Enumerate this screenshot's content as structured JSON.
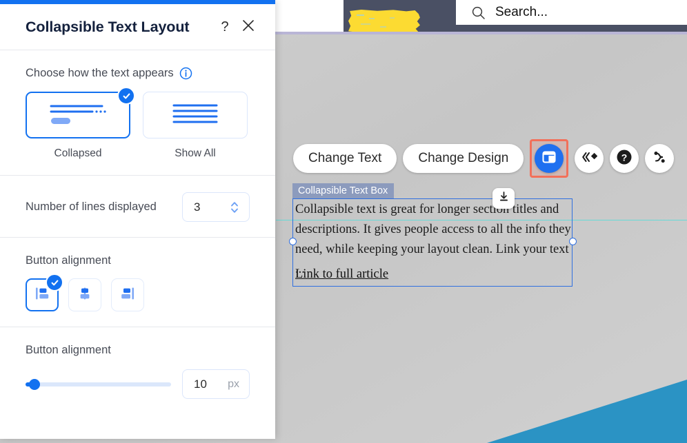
{
  "editor": {
    "search": {
      "placeholder_text": "Search...",
      "icon": "search-icon"
    },
    "toolbar": {
      "change_text_label": "Change Text",
      "change_design_label": "Change Design",
      "layout_icon": "layout-panel-icon",
      "animation_icon": "animation-icon",
      "help_icon": "help-circle-icon",
      "path_icon": "connector-path-icon"
    },
    "selection": {
      "element_label": "Collapsible Text Box",
      "body_text": "Collapsible text is great for longer section titles and descriptions. It gives people access to all the info they need, while keeping your layout clean. Link your text ...",
      "link_text": "Link to full article",
      "download_icon": "download-icon"
    },
    "colors": {
      "accent_blue": "#1f70f0",
      "selection_border": "#2f6fe0",
      "label_chip": "#8c9bbd",
      "guideline_teal": "#66d9d6",
      "header_dark": "#4a5064",
      "brush_yellow": "#fcdb32",
      "canvas_gray": "#c9c9c9",
      "wedge_teal": "#2b93c4",
      "highlight_orange": "#f2705a"
    }
  },
  "panel": {
    "title": "Collapsible Text Layout",
    "help_icon": "question-mark-icon",
    "close_icon": "close-x-icon",
    "top_accent_color": "#1271f0",
    "layout_section": {
      "label": "Choose how the text appears",
      "info_icon": "info-circle-icon",
      "options": [
        {
          "caption": "Collapsed",
          "selected": true,
          "icon": "collapsed-preview-icon"
        },
        {
          "caption": "Show All",
          "selected": false,
          "icon": "show-all-preview-icon"
        }
      ]
    },
    "lines_section": {
      "label": "Number of lines displayed",
      "value": "3",
      "stepper_icon": "stepper-arrows-icon"
    },
    "button_alignment_section": {
      "label": "Button alignment",
      "options": [
        {
          "name": "align-left",
          "selected": true
        },
        {
          "name": "align-center",
          "selected": false
        },
        {
          "name": "align-right",
          "selected": false
        }
      ]
    },
    "spacing_section": {
      "label": "Button alignment",
      "value": "10",
      "unit": "px",
      "slider_percent": 6
    }
  }
}
